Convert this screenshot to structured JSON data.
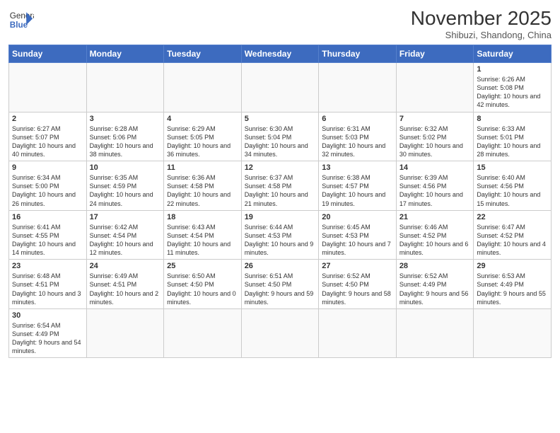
{
  "header": {
    "logo_text_normal": "General",
    "logo_text_bold": "Blue",
    "month": "November 2025",
    "location": "Shibuzi, Shandong, China"
  },
  "weekdays": [
    "Sunday",
    "Monday",
    "Tuesday",
    "Wednesday",
    "Thursday",
    "Friday",
    "Saturday"
  ],
  "weeks": [
    [
      {
        "day": "",
        "info": ""
      },
      {
        "day": "",
        "info": ""
      },
      {
        "day": "",
        "info": ""
      },
      {
        "day": "",
        "info": ""
      },
      {
        "day": "",
        "info": ""
      },
      {
        "day": "",
        "info": ""
      },
      {
        "day": "1",
        "info": "Sunrise: 6:26 AM\nSunset: 5:08 PM\nDaylight: 10 hours and 42 minutes."
      }
    ],
    [
      {
        "day": "2",
        "info": "Sunrise: 6:27 AM\nSunset: 5:07 PM\nDaylight: 10 hours and 40 minutes."
      },
      {
        "day": "3",
        "info": "Sunrise: 6:28 AM\nSunset: 5:06 PM\nDaylight: 10 hours and 38 minutes."
      },
      {
        "day": "4",
        "info": "Sunrise: 6:29 AM\nSunset: 5:05 PM\nDaylight: 10 hours and 36 minutes."
      },
      {
        "day": "5",
        "info": "Sunrise: 6:30 AM\nSunset: 5:04 PM\nDaylight: 10 hours and 34 minutes."
      },
      {
        "day": "6",
        "info": "Sunrise: 6:31 AM\nSunset: 5:03 PM\nDaylight: 10 hours and 32 minutes."
      },
      {
        "day": "7",
        "info": "Sunrise: 6:32 AM\nSunset: 5:02 PM\nDaylight: 10 hours and 30 minutes."
      },
      {
        "day": "8",
        "info": "Sunrise: 6:33 AM\nSunset: 5:01 PM\nDaylight: 10 hours and 28 minutes."
      }
    ],
    [
      {
        "day": "9",
        "info": "Sunrise: 6:34 AM\nSunset: 5:00 PM\nDaylight: 10 hours and 26 minutes."
      },
      {
        "day": "10",
        "info": "Sunrise: 6:35 AM\nSunset: 4:59 PM\nDaylight: 10 hours and 24 minutes."
      },
      {
        "day": "11",
        "info": "Sunrise: 6:36 AM\nSunset: 4:58 PM\nDaylight: 10 hours and 22 minutes."
      },
      {
        "day": "12",
        "info": "Sunrise: 6:37 AM\nSunset: 4:58 PM\nDaylight: 10 hours and 21 minutes."
      },
      {
        "day": "13",
        "info": "Sunrise: 6:38 AM\nSunset: 4:57 PM\nDaylight: 10 hours and 19 minutes."
      },
      {
        "day": "14",
        "info": "Sunrise: 6:39 AM\nSunset: 4:56 PM\nDaylight: 10 hours and 17 minutes."
      },
      {
        "day": "15",
        "info": "Sunrise: 6:40 AM\nSunset: 4:56 PM\nDaylight: 10 hours and 15 minutes."
      }
    ],
    [
      {
        "day": "16",
        "info": "Sunrise: 6:41 AM\nSunset: 4:55 PM\nDaylight: 10 hours and 14 minutes."
      },
      {
        "day": "17",
        "info": "Sunrise: 6:42 AM\nSunset: 4:54 PM\nDaylight: 10 hours and 12 minutes."
      },
      {
        "day": "18",
        "info": "Sunrise: 6:43 AM\nSunset: 4:54 PM\nDaylight: 10 hours and 11 minutes."
      },
      {
        "day": "19",
        "info": "Sunrise: 6:44 AM\nSunset: 4:53 PM\nDaylight: 10 hours and 9 minutes."
      },
      {
        "day": "20",
        "info": "Sunrise: 6:45 AM\nSunset: 4:53 PM\nDaylight: 10 hours and 7 minutes."
      },
      {
        "day": "21",
        "info": "Sunrise: 6:46 AM\nSunset: 4:52 PM\nDaylight: 10 hours and 6 minutes."
      },
      {
        "day": "22",
        "info": "Sunrise: 6:47 AM\nSunset: 4:52 PM\nDaylight: 10 hours and 4 minutes."
      }
    ],
    [
      {
        "day": "23",
        "info": "Sunrise: 6:48 AM\nSunset: 4:51 PM\nDaylight: 10 hours and 3 minutes."
      },
      {
        "day": "24",
        "info": "Sunrise: 6:49 AM\nSunset: 4:51 PM\nDaylight: 10 hours and 2 minutes."
      },
      {
        "day": "25",
        "info": "Sunrise: 6:50 AM\nSunset: 4:50 PM\nDaylight: 10 hours and 0 minutes."
      },
      {
        "day": "26",
        "info": "Sunrise: 6:51 AM\nSunset: 4:50 PM\nDaylight: 9 hours and 59 minutes."
      },
      {
        "day": "27",
        "info": "Sunrise: 6:52 AM\nSunset: 4:50 PM\nDaylight: 9 hours and 58 minutes."
      },
      {
        "day": "28",
        "info": "Sunrise: 6:52 AM\nSunset: 4:49 PM\nDaylight: 9 hours and 56 minutes."
      },
      {
        "day": "29",
        "info": "Sunrise: 6:53 AM\nSunset: 4:49 PM\nDaylight: 9 hours and 55 minutes."
      }
    ],
    [
      {
        "day": "30",
        "info": "Sunrise: 6:54 AM\nSunset: 4:49 PM\nDaylight: 9 hours and 54 minutes."
      },
      {
        "day": "",
        "info": ""
      },
      {
        "day": "",
        "info": ""
      },
      {
        "day": "",
        "info": ""
      },
      {
        "day": "",
        "info": ""
      },
      {
        "day": "",
        "info": ""
      },
      {
        "day": "",
        "info": ""
      }
    ]
  ]
}
